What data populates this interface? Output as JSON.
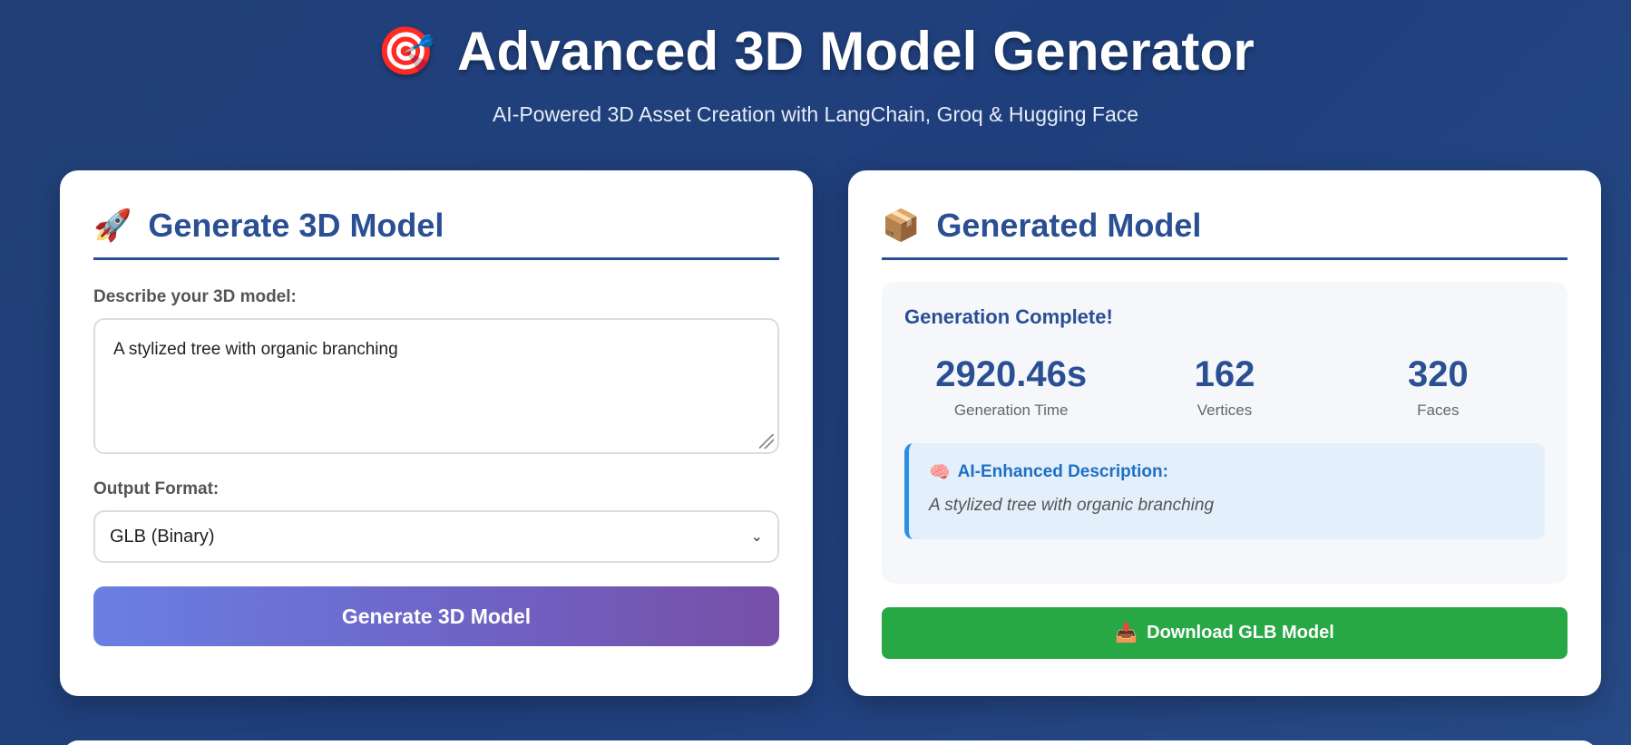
{
  "header": {
    "icon": "target-icon",
    "title": "Advanced 3D Model Generator",
    "subtitle": "AI-Powered 3D Asset Creation with LangChain, Groq & Hugging Face"
  },
  "generate_panel": {
    "icon": "rocket-icon",
    "title": "Generate 3D Model",
    "prompt_label": "Describe your 3D model:",
    "prompt_value": "A stylized tree with organic branching",
    "format_label": "Output Format:",
    "format_selected": "GLB (Binary)",
    "button_label": "Generate 3D Model"
  },
  "result_panel": {
    "icon": "package-icon",
    "title": "Generated Model",
    "status": "Generation Complete!",
    "stats": [
      {
        "value": "2920.46s",
        "label": "Generation Time"
      },
      {
        "value": "162",
        "label": "Vertices"
      },
      {
        "value": "320",
        "label": "Faces"
      }
    ],
    "description_icon": "brain-icon",
    "description_title": "AI-Enhanced Description:",
    "description_text": "A stylized tree with organic branching",
    "download_icon": "inbox-tray-icon",
    "download_label": "Download GLB Model"
  },
  "colors": {
    "background": "#22417a",
    "accent": "#2a4f93",
    "download": "#28a745",
    "info": "#1f6fc5"
  }
}
